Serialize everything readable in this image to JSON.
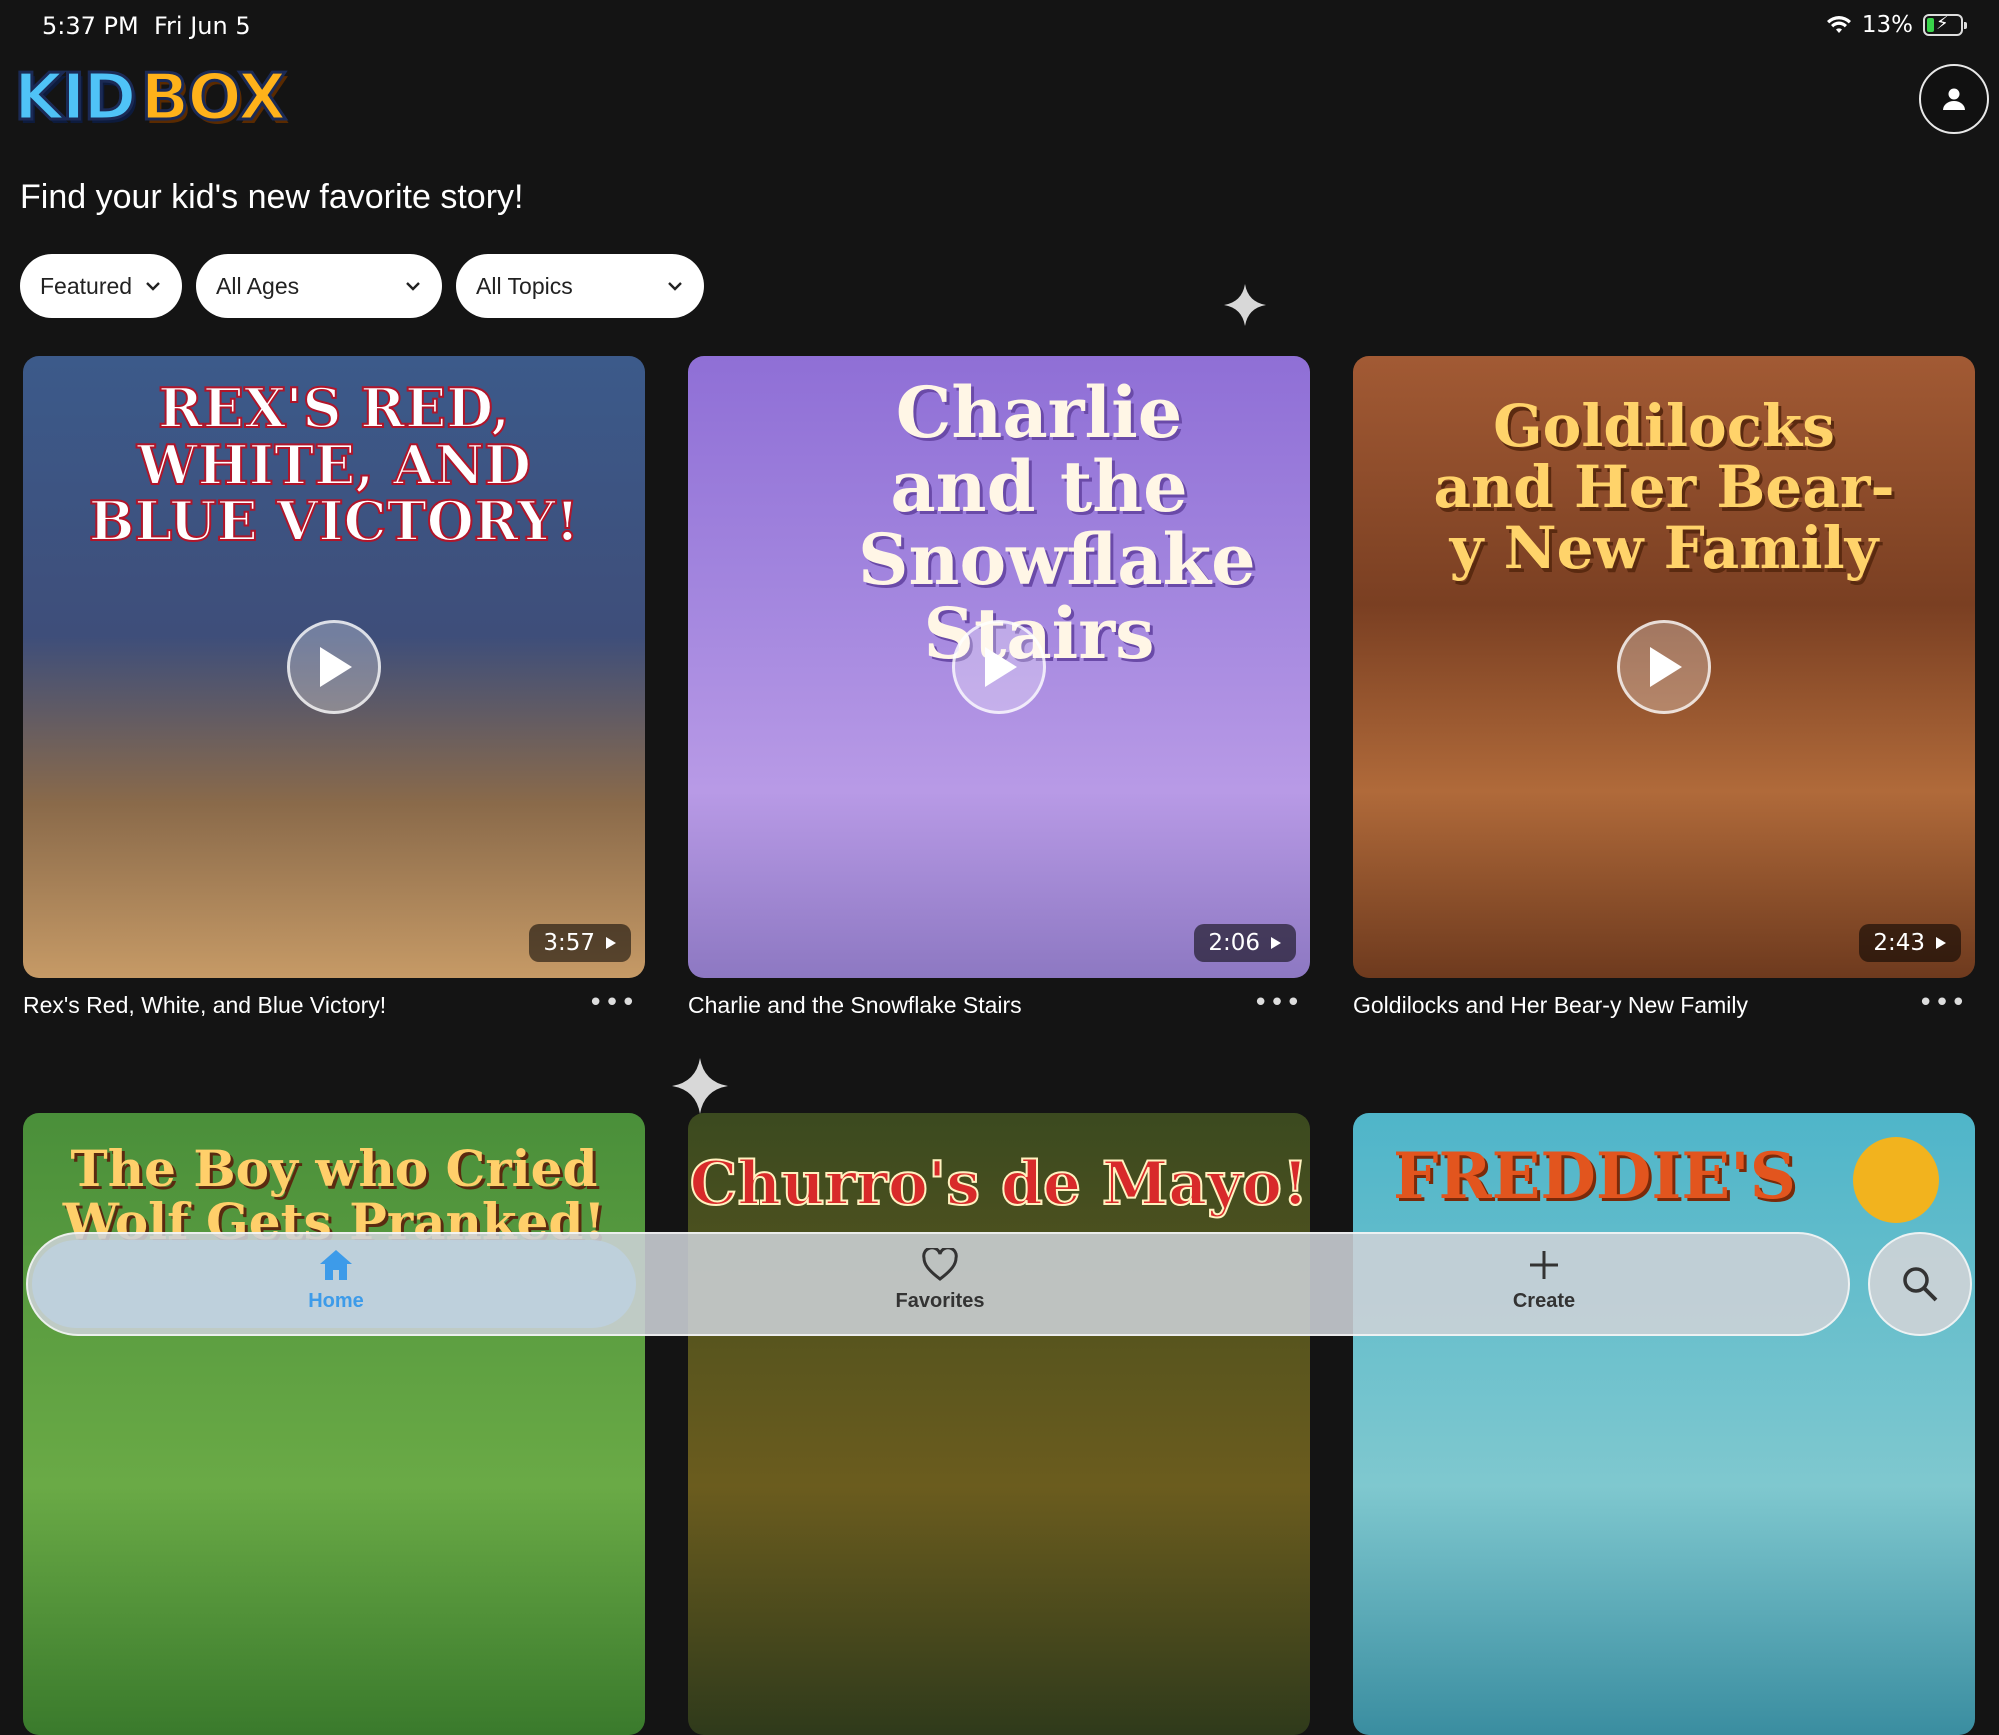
{
  "status_bar": {
    "time": "5:37 PM",
    "date": "Fri Jun 5",
    "battery": "13%"
  },
  "header": {
    "logo_kid": "KID",
    "logo_box": "BOX"
  },
  "headline": "Find your kid's new favorite story!",
  "filters": [
    {
      "label": "Featured"
    },
    {
      "label": "All Ages"
    },
    {
      "label": "All Topics"
    }
  ],
  "stories": [
    {
      "title": "Rex's Red, White, and Blue Victory!",
      "art_title": "REX'S RED, WHITE, AND BLUE VICTORY!",
      "duration": "3:57"
    },
    {
      "title": "Charlie and the Snowflake Stairs",
      "art_title": "Charlie and the Snowflake Stairs",
      "duration": "2:06"
    },
    {
      "title": "Goldilocks and Her Bear-y New Family",
      "art_title": "Goldilocks and Her Bear-y New Family",
      "duration": "2:43"
    },
    {
      "art_title": "The Boy who Cried Wolf Gets Pranked!"
    },
    {
      "art_title": "Churro's de Mayo!"
    },
    {
      "art_title": "FREDDIE'S"
    }
  ],
  "nav": {
    "home": "Home",
    "favorites": "Favorites",
    "create": "Create"
  },
  "colors": {
    "accent": "#3d9be9",
    "background": "#141414"
  }
}
